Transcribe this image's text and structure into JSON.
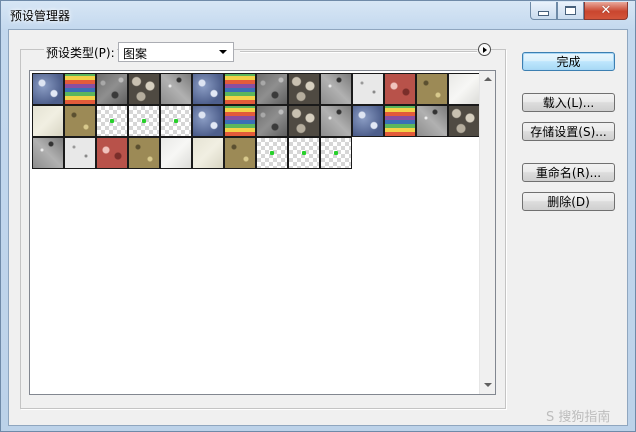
{
  "window": {
    "title": "预设管理器"
  },
  "caption_buttons": {
    "minimize": "minimize",
    "maximize": "maximize",
    "close": "✕"
  },
  "preset_type": {
    "label": "预设类型(P):",
    "value": "图案"
  },
  "patterns": [
    [
      "blue",
      "rainbow",
      "gray",
      "pebble",
      "granite",
      "blue",
      "rainbow",
      "gray",
      "pebble",
      "granite",
      "light",
      "red",
      "tan",
      "white"
    ],
    [
      "cream",
      "tan",
      "check",
      "check",
      "check",
      "blue",
      "rainbow",
      "gray",
      "pebble",
      "granite",
      "blue",
      "rainbow",
      "granite",
      "pebble"
    ],
    [
      "granite",
      "light",
      "red",
      "tan",
      "white",
      "cream",
      "tan",
      "check",
      "check",
      "check"
    ]
  ],
  "buttons": {
    "done": "完成",
    "load": "载入(L)...",
    "save_set": "存储设置(S)...",
    "rename": "重命名(R)...",
    "delete": "删除(D)"
  },
  "watermark": "S 搜狗指南"
}
